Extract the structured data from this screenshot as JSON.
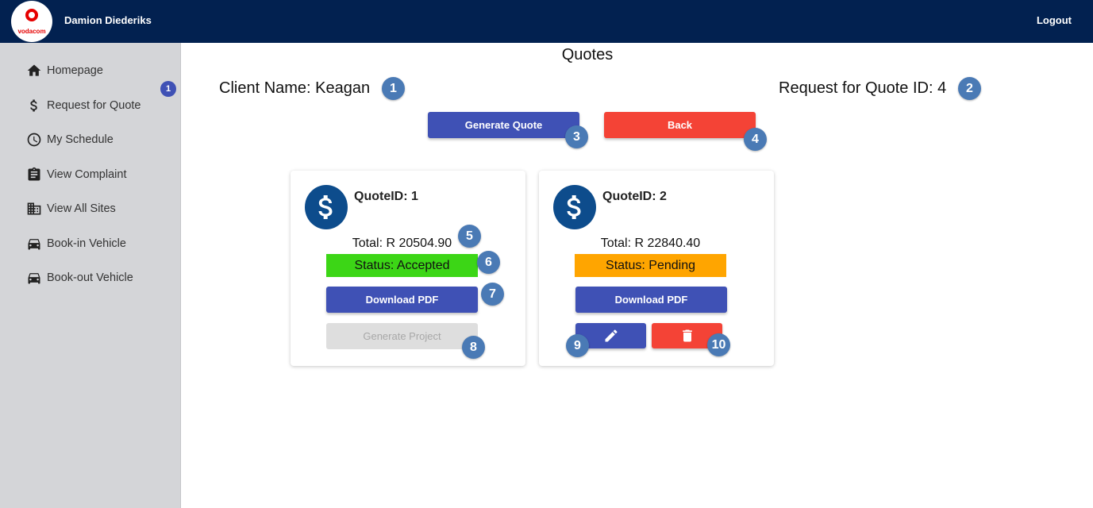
{
  "header": {
    "logo_text": "vodacom",
    "user_name": "Damion Diederiks",
    "logout_label": "Logout"
  },
  "sidebar": {
    "items": [
      {
        "label": "Homepage",
        "icon": "home-icon"
      },
      {
        "label": "Request for Quote",
        "icon": "dollar-icon"
      },
      {
        "label": "My Schedule",
        "icon": "clock-icon"
      },
      {
        "label": "View Complaint",
        "icon": "clipboard-icon"
      },
      {
        "label": "View All Sites",
        "icon": "building-icon"
      },
      {
        "label": "Book-in Vehicle",
        "icon": "car-icon"
      },
      {
        "label": "Book-out Vehicle",
        "icon": "car-icon"
      }
    ],
    "badge": "1"
  },
  "main": {
    "title": "Quotes",
    "client_name": "Client Name: Keagan",
    "rfq_id": "Request for Quote ID: 4",
    "generate_quote_label": "Generate Quote",
    "back_label": "Back"
  },
  "quotes": [
    {
      "quote_id": "QuoteID: 1",
      "total": "Total: R 20504.90",
      "status": "Status: Accepted",
      "status_color": "#3cd616",
      "download_label": "Download PDF",
      "generate_project_label": "Generate Project"
    },
    {
      "quote_id": "QuoteID: 2",
      "total": "Total: R 22840.40",
      "status": "Status: Pending",
      "status_color": "#ffa500",
      "download_label": "Download PDF"
    }
  ],
  "callouts": [
    "1",
    "2",
    "3",
    "4",
    "5",
    "6",
    "7",
    "8",
    "9",
    "10"
  ],
  "colors": {
    "header_bg": "#022150",
    "primary": "#3f51b5",
    "danger": "#f44336",
    "callout": "#4a7ab5"
  }
}
